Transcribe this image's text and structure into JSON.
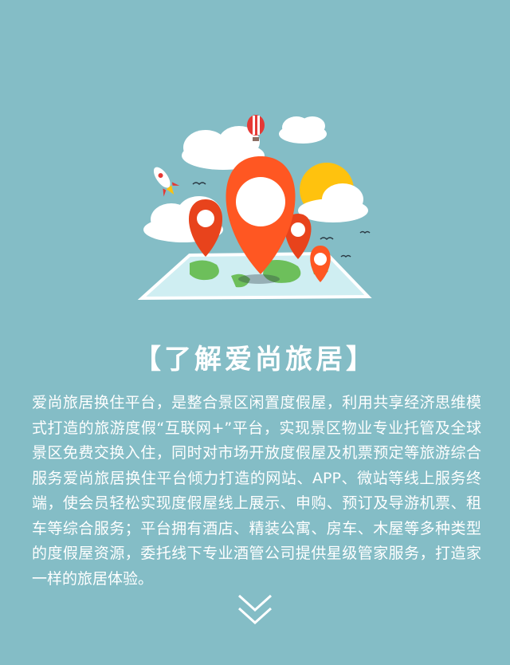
{
  "header": {
    "title": "【了解爱尚旅居】"
  },
  "intro": {
    "paragraph": "爱尚旅居换住平台，是整合景区闲置度假屋，利用共享经济思维模式打造的旅游度假“互联网+”平台，实现景区物业专业托管及全球景区免费交换入住，同时对市场开放度假屋及机票预定等旅游综合服务爱尚旅居换住平台倾力打造的网站、APP、微站等线上服务终端，使会员轻松实现度假屋线上展示、申购、预订及导游机票、租车等综合服务；平台拥有酒店、精装公寓、房车、木屋等多种类型的度假屋资源，委托线下专业酒管公司提供星级管家服务，打造家一样的旅居体验。"
  },
  "icons": {
    "illustration": "map-pins-travel-illustration",
    "more": "double-chevron-down-icon"
  },
  "colors": {
    "background": "#84bdc6",
    "pin_orange": "#ff5722",
    "pin_dark": "#e0401a",
    "sun": "#ffc20e",
    "text": "#ffffff"
  }
}
